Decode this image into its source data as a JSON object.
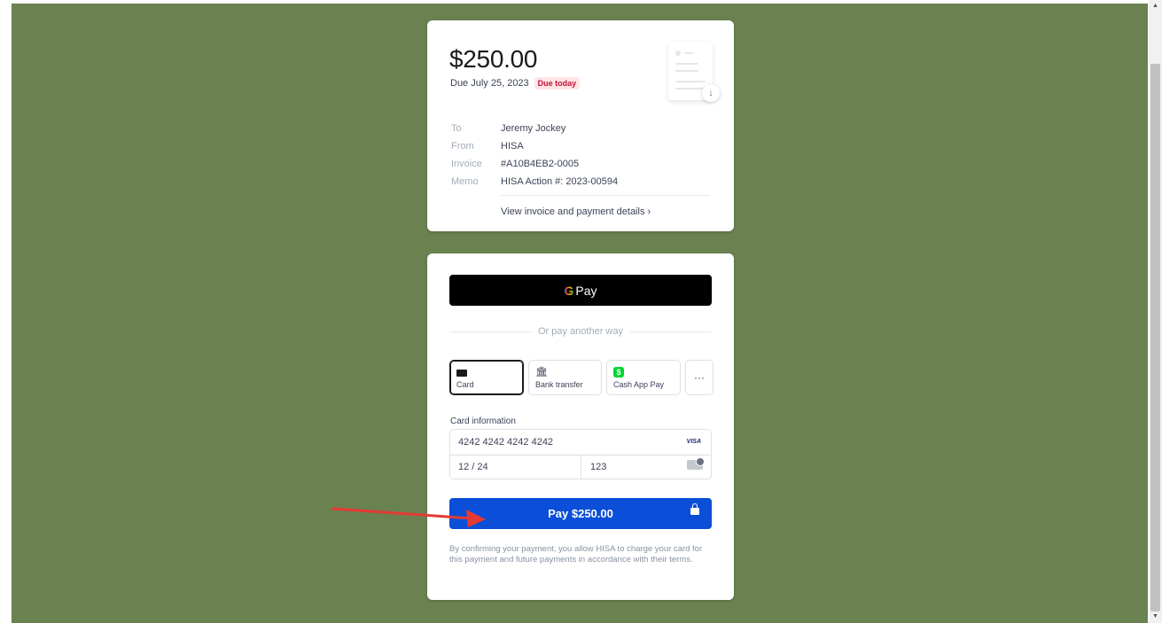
{
  "invoice": {
    "amount": "$250.00",
    "due_date": "Due July 25, 2023",
    "due_badge": "Due today",
    "details": [
      {
        "label": "To",
        "value": "Jeremy Jockey"
      },
      {
        "label": "From",
        "value": "HISA"
      },
      {
        "label": "Invoice",
        "value": "#A10B4EB2-0005"
      },
      {
        "label": "Memo",
        "value": "HISA Action #: 2023-00594"
      }
    ],
    "view_link": "View invoice and payment details",
    "view_link_chevron": "›"
  },
  "payment": {
    "gpay_logo": "G",
    "gpay_label": "Pay",
    "divider_text": "Or pay another way",
    "methods": [
      {
        "label": "Card",
        "icon": "card-icon",
        "active": true
      },
      {
        "label": "Bank transfer",
        "icon": "bank-icon",
        "active": false
      },
      {
        "label": "Cash App Pay",
        "icon": "cashapp-icon",
        "active": false
      }
    ],
    "more_label": "···",
    "card_info_label": "Card information",
    "card_number": "4242 4242 4242 4242",
    "card_brand": "VISA",
    "expiry": "12 / 24",
    "cvc": "123",
    "pay_button": "Pay $250.00",
    "terms": "By confirming your payment, you allow HISA to charge your card for this payment and future payments in accordance with their terms."
  },
  "colors": {
    "background": "#6a8150",
    "pay_button": "#0b4fd8",
    "badge_bg": "#ffe5e5",
    "badge_text": "#c0123c",
    "arrow": "#e53935"
  }
}
